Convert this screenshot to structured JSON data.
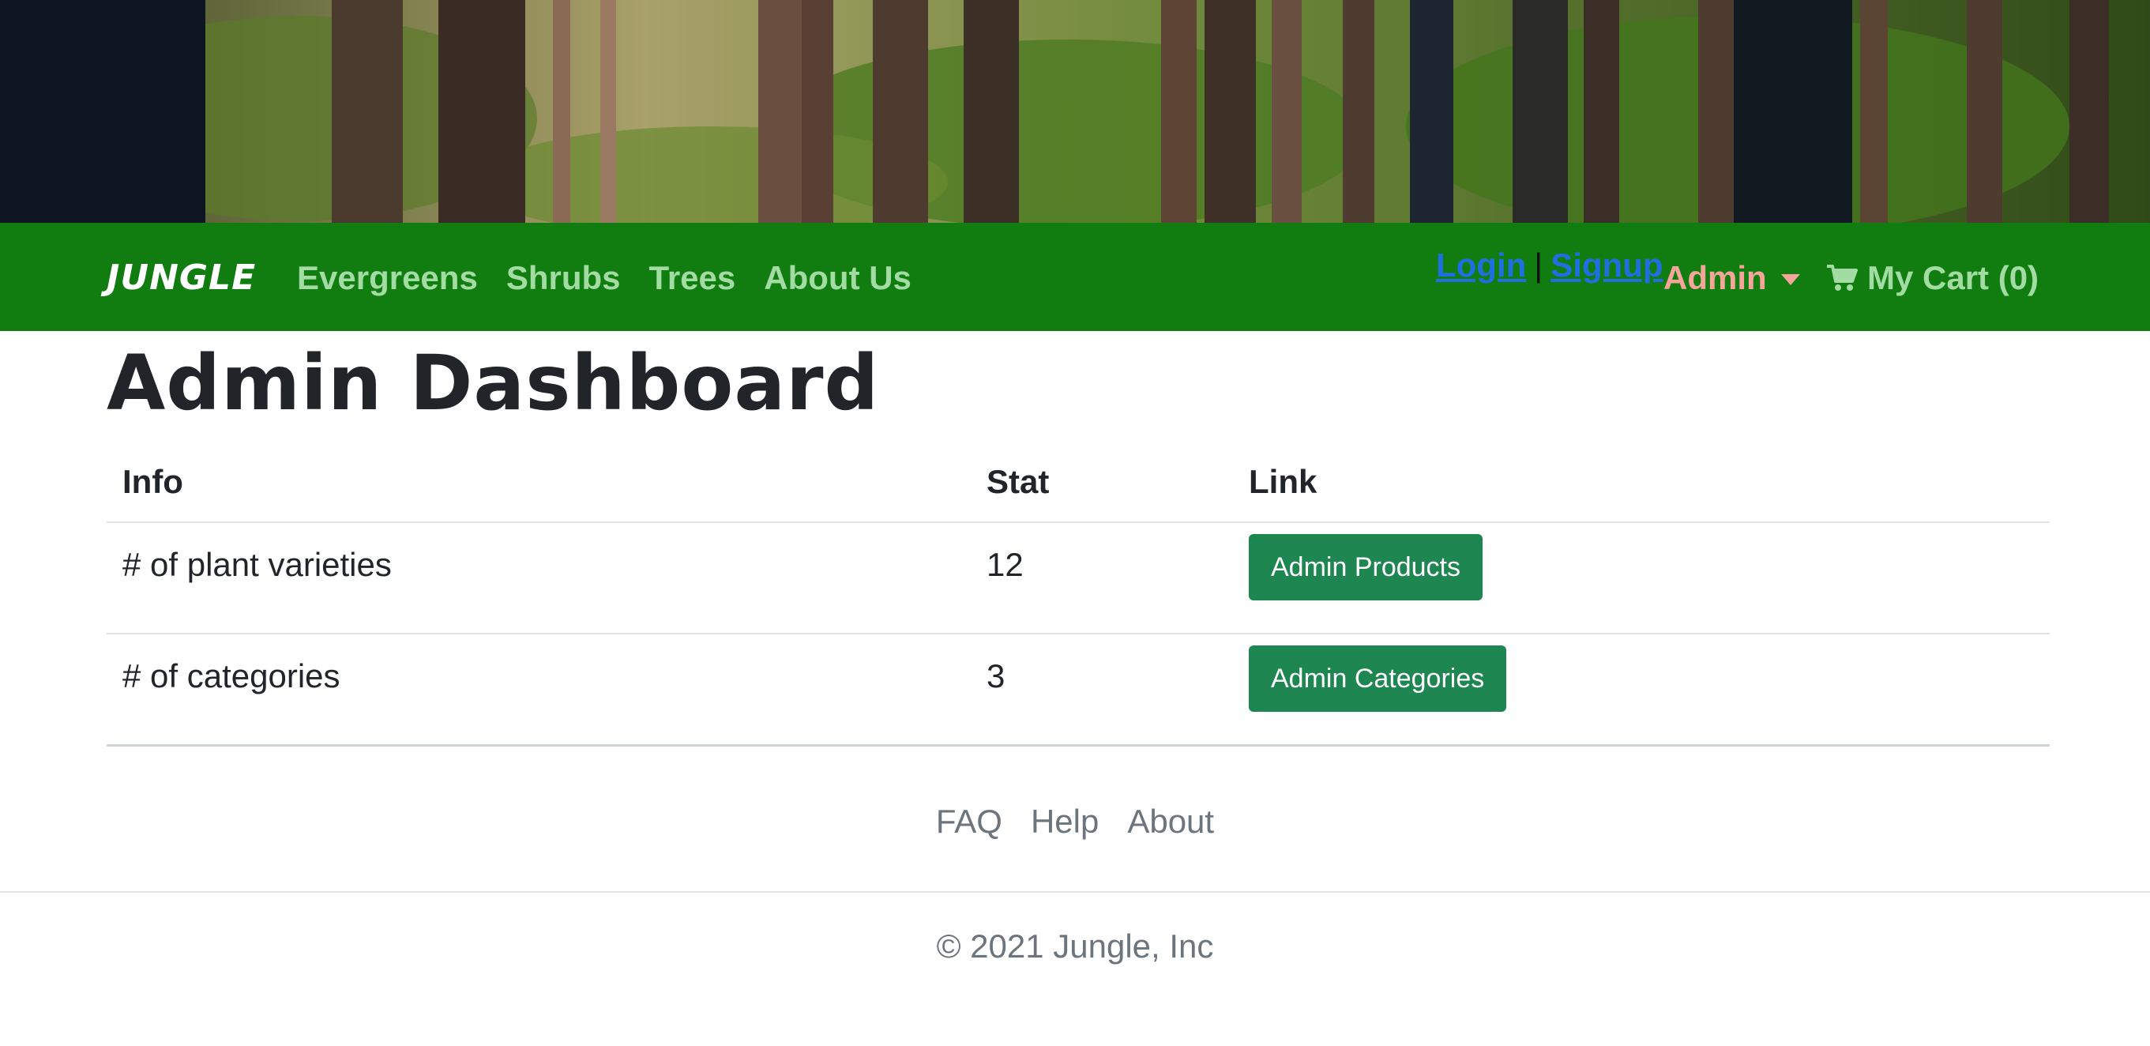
{
  "navbar": {
    "brand": "JUNGLE",
    "links": [
      "Evergreens",
      "Shrubs",
      "Trees",
      "About Us"
    ],
    "login_label": "Login",
    "separator": "|",
    "signup_label": "Signup",
    "admin_label": "Admin",
    "cart_label": "My Cart (0)",
    "bg_color": "#117d11"
  },
  "main": {
    "title": "Admin Dashboard",
    "table": {
      "headers": [
        "Info",
        "Stat",
        "Link"
      ],
      "rows": [
        {
          "info": "# of plant varieties",
          "stat": "12",
          "link_label": "Admin Products"
        },
        {
          "info": "# of categories",
          "stat": "3",
          "link_label": "Admin Categories"
        }
      ]
    },
    "button_color": "#1e8751"
  },
  "footer": {
    "links": [
      "FAQ",
      "Help",
      "About"
    ],
    "copyright": "© 2021 Jungle, Inc"
  },
  "icons": {
    "cart": "cart-icon",
    "dropdown": "caret-down-icon"
  }
}
